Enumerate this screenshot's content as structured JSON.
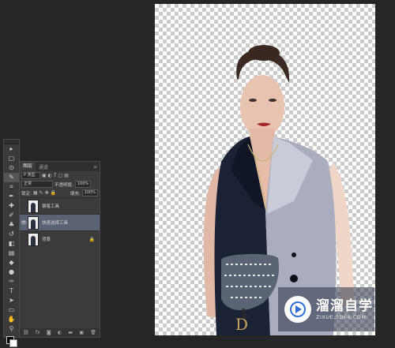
{
  "toolbar": {
    "tools": [
      {
        "name": "move-tool-icon",
        "glyph": "▸"
      },
      {
        "name": "marquee-tool-icon",
        "glyph": "▢"
      },
      {
        "name": "lasso-tool-icon",
        "glyph": "⊙"
      },
      {
        "name": "quick-selection-tool-icon",
        "glyph": "✎",
        "active": true
      },
      {
        "name": "crop-tool-icon",
        "glyph": "⌗"
      },
      {
        "name": "eyedropper-tool-icon",
        "glyph": "✒"
      },
      {
        "name": "healing-brush-tool-icon",
        "glyph": "✚"
      },
      {
        "name": "brush-tool-icon",
        "glyph": "✐"
      },
      {
        "name": "clone-stamp-tool-icon",
        "glyph": "♣"
      },
      {
        "name": "history-brush-tool-icon",
        "glyph": "↺"
      },
      {
        "name": "eraser-tool-icon",
        "glyph": "◧"
      },
      {
        "name": "gradient-tool-icon",
        "glyph": "▤"
      },
      {
        "name": "blur-tool-icon",
        "glyph": "◆"
      },
      {
        "name": "dodge-tool-icon",
        "glyph": "●"
      },
      {
        "name": "pen-tool-icon",
        "glyph": "✑"
      },
      {
        "name": "type-tool-icon",
        "glyph": "T"
      },
      {
        "name": "path-selection-tool-icon",
        "glyph": "➤"
      },
      {
        "name": "shape-tool-icon",
        "glyph": "▭"
      },
      {
        "name": "hand-tool-icon",
        "glyph": "✋"
      },
      {
        "name": "zoom-tool-icon",
        "glyph": "⚲"
      }
    ]
  },
  "layers_panel": {
    "tabs": [
      "图层",
      "通道"
    ],
    "filter_label": "P 类型",
    "blend_mode": "正常",
    "opacity_label": "不透明度:",
    "opacity_value": "100%",
    "lock_label": "锁定:",
    "fill_label": "填充:",
    "fill_value": "100%",
    "layers": [
      {
        "name": "钢笔工具",
        "visible": false,
        "selected": false,
        "locked": false
      },
      {
        "name": "快速选择工具",
        "visible": true,
        "selected": true,
        "locked": false
      },
      {
        "name": "背景",
        "visible": false,
        "selected": false,
        "locked": true
      }
    ]
  },
  "watermark": {
    "title": "溜溜自学",
    "subtitle": "ZIXUE.3D66.COM"
  },
  "colors": {
    "workspace": "#262626",
    "panel": "#3b3b3b",
    "selected_layer": "#5b6273",
    "watermark_bg": "#283046"
  }
}
